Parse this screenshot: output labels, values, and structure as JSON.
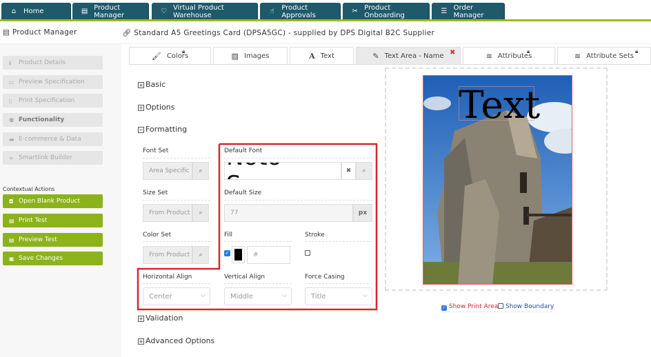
{
  "nav": {
    "tabs": [
      {
        "label": "Home",
        "icon": "home-icon"
      },
      {
        "label": "Product Manager",
        "icon": "document-icon"
      },
      {
        "label": "Virtual Product Warehouse",
        "icon": "heart-icon"
      },
      {
        "label": "Product Approvals",
        "icon": "thumbs-up-icon"
      },
      {
        "label": "Product Onboarding",
        "icon": "tools-icon"
      },
      {
        "label": "Order Manager",
        "icon": "list-icon"
      }
    ]
  },
  "header": {
    "section": "Product Manager",
    "product_title": "Standard A5 Greetings Card (DPSA5GC) - supplied by DPS Digital B2C Supplier"
  },
  "sidebar": {
    "items": [
      "Product Details",
      "Preview Specification",
      "Print Specification",
      "Functionality",
      "E-commerce & Data",
      "Smartlink Builder"
    ],
    "contextual_label": "Contextual Actions",
    "actions": [
      "Open Blank Product",
      "Print Test",
      "Preview Test",
      "Save Changes"
    ]
  },
  "tabs": [
    {
      "label": "Colors",
      "locked": true
    },
    {
      "label": "Images",
      "locked": false
    },
    {
      "label": "Text",
      "locked": false
    },
    {
      "label": "Text Area - Name",
      "closable": true
    },
    {
      "label": "Attributes",
      "locked": true
    },
    {
      "label": "Attribute Sets",
      "locked": true
    }
  ],
  "sections": {
    "basic": "Basic",
    "options": "Options",
    "formatting": "Formatting",
    "validation": "Validation",
    "advanced": "Advanced Options"
  },
  "formatting": {
    "font_set_label": "Font Set",
    "font_set_value": "Area Specific",
    "default_font_label": "Default Font",
    "default_font_value": "Noto Sans",
    "size_set_label": "Size Set",
    "size_set_value": "From Product",
    "default_size_label": "Default Size",
    "default_size_placeholder": "77",
    "default_size_unit": "px",
    "color_set_label": "Color Set",
    "color_set_value": "From Product",
    "fill_label": "Fill",
    "fill_checked": true,
    "fill_color": "#000000",
    "fill_hex_placeholder": "#",
    "stroke_label": "Stroke",
    "stroke_checked": false,
    "halign_label": "Horizontal Align",
    "halign_value": "Center",
    "valign_label": "Vertical Align",
    "valign_value": "Middle",
    "casing_label": "Force Casing",
    "casing_value": "Title"
  },
  "preview": {
    "text": "Text",
    "show_print_area_label": "Show Print Area",
    "show_print_area_checked": true,
    "show_boundary_label": "Show Boundary",
    "show_boundary_checked": false
  },
  "colors": {
    "nav_bg": "#1e5a6a",
    "accent_green": "#8cb21c",
    "highlight_red": "#d6262f"
  }
}
